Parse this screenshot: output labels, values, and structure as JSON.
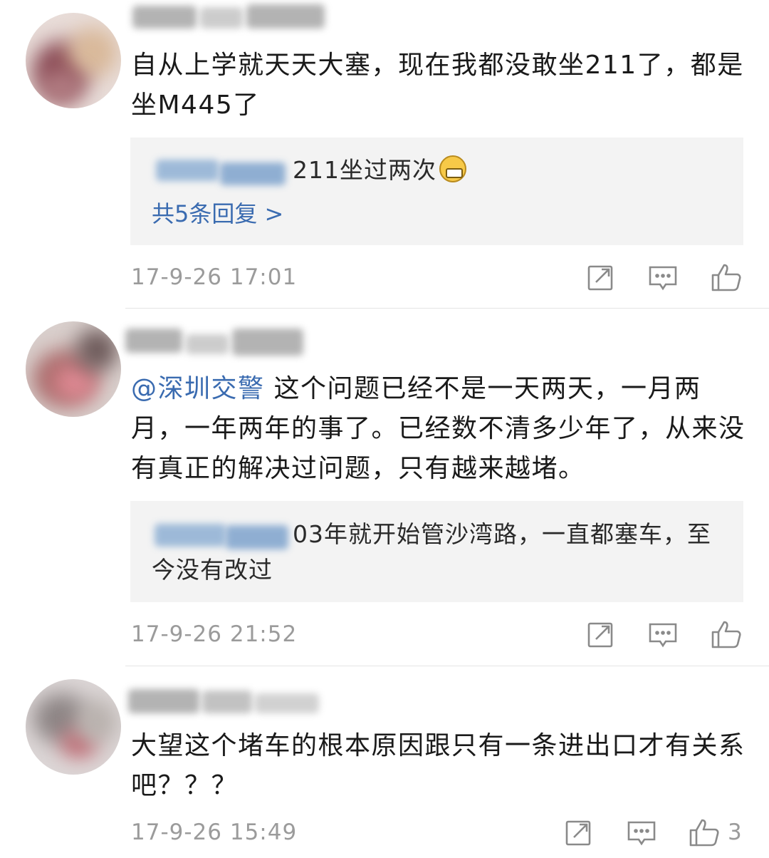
{
  "comments": [
    {
      "text": "自从上学就天天大塞，现在我都没敢坐211了，都是坐M445了",
      "reply": {
        "text": "211坐过两次",
        "emoji": "grin-emoji"
      },
      "reply_more": "共5条回复 >",
      "time": "17-9-26 17:01"
    },
    {
      "mention": "@深圳交警",
      "text": " 这个问题已经不是一天两天，一月两月，一年两年的事了。已经数不清多少年了，从来没有真正的解决过问题，只有越来越堵。",
      "reply": {
        "text": "03年就开始管沙湾路，一直都塞车，至今没有改过"
      },
      "time": "17-9-26 21:52"
    },
    {
      "text": "大望这个堵车的根本原因跟只有一条进出口才有关系吧？？？",
      "time": "17-9-26 15:49",
      "like_count": "3"
    }
  ],
  "icons": {
    "repost": "repost-icon",
    "comment": "comment-icon",
    "like": "thumbs-up-icon"
  },
  "colors": {
    "link": "#3a6bb0",
    "meta": "#9b9b9b",
    "reply_bg": "#f3f3f3"
  }
}
